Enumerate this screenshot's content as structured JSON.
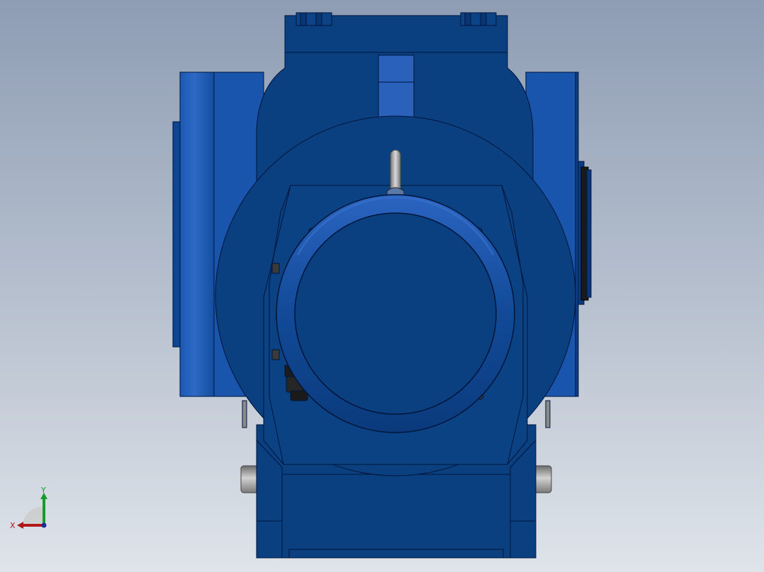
{
  "viewport": {
    "background_top": "#8e9db4",
    "background_bottom": "#dfe4ea"
  },
  "model": {
    "body_color": "#0a3f80",
    "body_dark": "#042d63",
    "highlight_color": "#2f63b8",
    "edge_color": "#00153a",
    "pin_color": "#a4a4a4"
  },
  "triad": {
    "x_label": "X",
    "y_label": "Y",
    "x_color": "#b01818",
    "y_color": "#1a9a2a"
  }
}
